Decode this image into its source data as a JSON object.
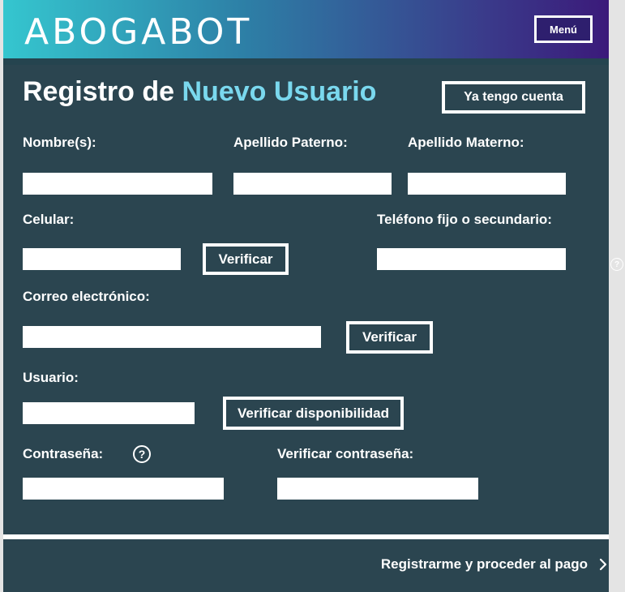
{
  "header": {
    "logo_text": "ABOGABOT",
    "menu_label": "Menú"
  },
  "form": {
    "title_part1": "Registro de",
    "title_part2": "Nuevo Usuario",
    "have_account_label": "Ya tengo cuenta",
    "fields": {
      "nombres_label": "Nombre(s):",
      "apellido_paterno_label": "Apellido Paterno:",
      "apellido_materno_label": "Apellido Materno:",
      "celular_label": "Celular:",
      "telefono_label": "Teléfono fijo o secundario:",
      "correo_label": "Correo electrónico:",
      "usuario_label": "Usuario:",
      "contrasena_label": "Contraseña:",
      "verificar_contrasena_label": "Verificar contraseña:"
    },
    "buttons": {
      "verify_phone": "Verificar",
      "verify_email": "Verificar",
      "check_availability": "Verificar disponibilidad"
    },
    "help_icon_glyph": "?"
  },
  "footer": {
    "submit_label": "Registrarme y proceder al pago"
  },
  "colors": {
    "form_bg": "#2b4550",
    "accent_text": "#7ad8ee"
  }
}
